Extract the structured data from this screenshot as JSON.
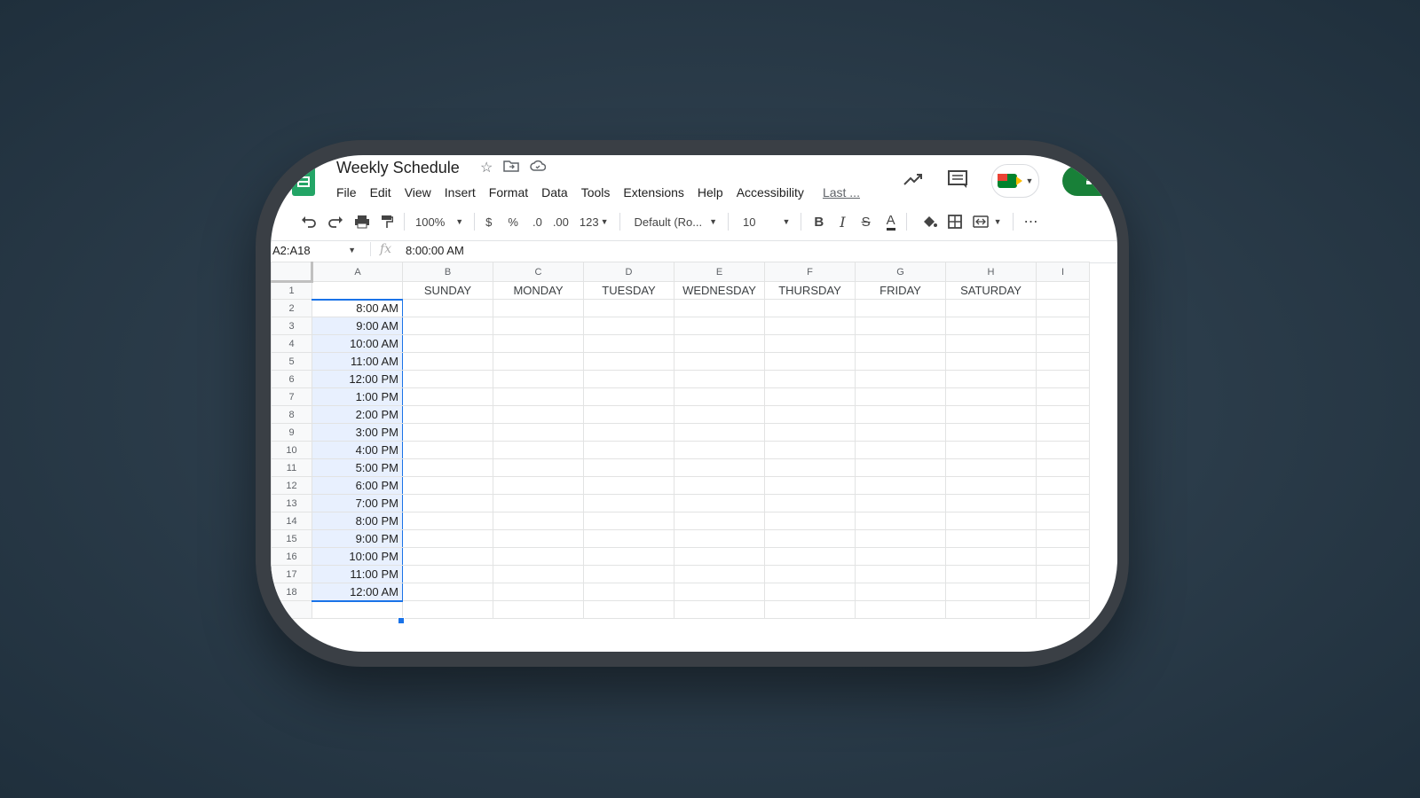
{
  "app": {
    "doc_title": "Weekly Schedule",
    "menus": [
      "File",
      "Edit",
      "View",
      "Insert",
      "Format",
      "Data",
      "Tools",
      "Extensions",
      "Help",
      "Accessibility"
    ],
    "last_edit": "Last ..."
  },
  "toolbar": {
    "zoom": "100%",
    "currency": "$",
    "percent": "%",
    "dec_decrease": ".0",
    "dec_increase": ".00",
    "number_format": "123",
    "font": "Default (Ro...",
    "font_size": "10",
    "bold": "B",
    "italic": "I",
    "strike": "S",
    "text_color": "A",
    "more": "⋯"
  },
  "formula_bar": {
    "name_box": "A2:A18",
    "fx": "fx",
    "value": "8:00:00 AM"
  },
  "sheet": {
    "columns": [
      "A",
      "B",
      "C",
      "D",
      "E",
      "F",
      "G",
      "H",
      "I"
    ],
    "days": [
      "SUNDAY",
      "MONDAY",
      "TUESDAY",
      "WEDNESDAY",
      "THURSDAY",
      "FRIDAY",
      "SATURDAY"
    ],
    "row_numbers": [
      "1",
      "2",
      "3",
      "4",
      "5",
      "6",
      "7",
      "8",
      "9",
      "10",
      "11",
      "12",
      "13",
      "14",
      "15",
      "16",
      "17",
      "18"
    ],
    "times": [
      "8:00 AM",
      "9:00 AM",
      "10:00 AM",
      "11:00 AM",
      "12:00 PM",
      "1:00 PM",
      "2:00 PM",
      "3:00 PM",
      "4:00 PM",
      "5:00 PM",
      "6:00 PM",
      "7:00 PM",
      "8:00 PM",
      "9:00 PM",
      "10:00 PM",
      "11:00 PM",
      "12:00 AM"
    ]
  },
  "colors": {
    "selection": "#1a73e8",
    "sheets_green": "#23a566",
    "share_green": "#188038"
  }
}
